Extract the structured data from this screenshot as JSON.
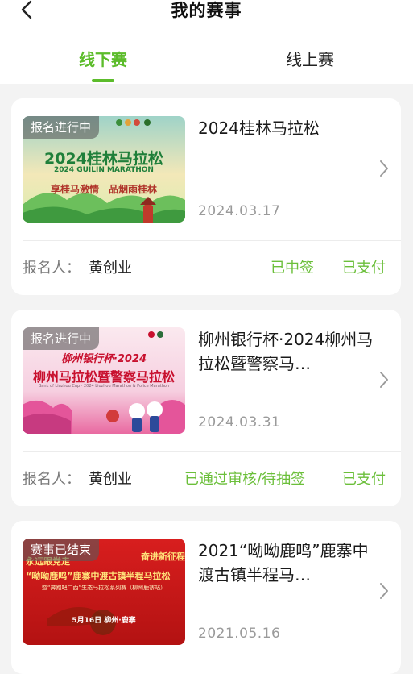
{
  "header": {
    "title": "我的赛事"
  },
  "tabs": [
    {
      "label": "线下赛",
      "active": true
    },
    {
      "label": "线上赛",
      "active": false
    }
  ],
  "colors": {
    "accent": "#5cbc2b",
    "status_text": "#6bbf3a",
    "muted": "#9a9a9a"
  },
  "icons": {
    "back": "chevron-left-icon",
    "row": "chevron-right-icon"
  },
  "events": [
    {
      "tag": "报名进行中",
      "banner": {
        "title": "2024桂林马拉松",
        "subtitle": "2024 GUILIN MARATHON",
        "slogan": "享桂马激情　品烟雨桂林"
      },
      "name": "2024桂林马拉松",
      "date": "2024.03.17",
      "registrant_label": "报名人：",
      "registrant": "黄创业",
      "status_1": "已中签",
      "status_2": "已支付"
    },
    {
      "tag": "报名进行中",
      "banner": {
        "title_top": "柳州银行杯·2024",
        "title": "柳州马拉松暨警察马拉松",
        "subtitle": "Bank of Liuzhou Cup · 2024 Liuzhou Marathon & Police Marathon"
      },
      "name": "柳州银行杯·2024柳州马拉松暨警察马…",
      "date": "2024.03.31",
      "registrant_label": "报名人：",
      "registrant": "黄创业",
      "status_1": "已通过审核/待抽签",
      "status_2": "已支付"
    },
    {
      "tag": "赛事已结束",
      "banner": {
        "left_text": "永远跟党走",
        "right_text": "奋进新征程",
        "title": "“呦呦鹿鸣”鹿寨中渡古镇半程马拉松",
        "subtitle": "暨“奔跑吧广西”生态马拉松系列赛（柳州鹿寨站）",
        "date_text": "5月16日  柳州·鹿寨"
      },
      "name": "2021“呦呦鹿鸣”鹿寨中渡古镇半程马…",
      "date": "2021.05.16"
    }
  ]
}
